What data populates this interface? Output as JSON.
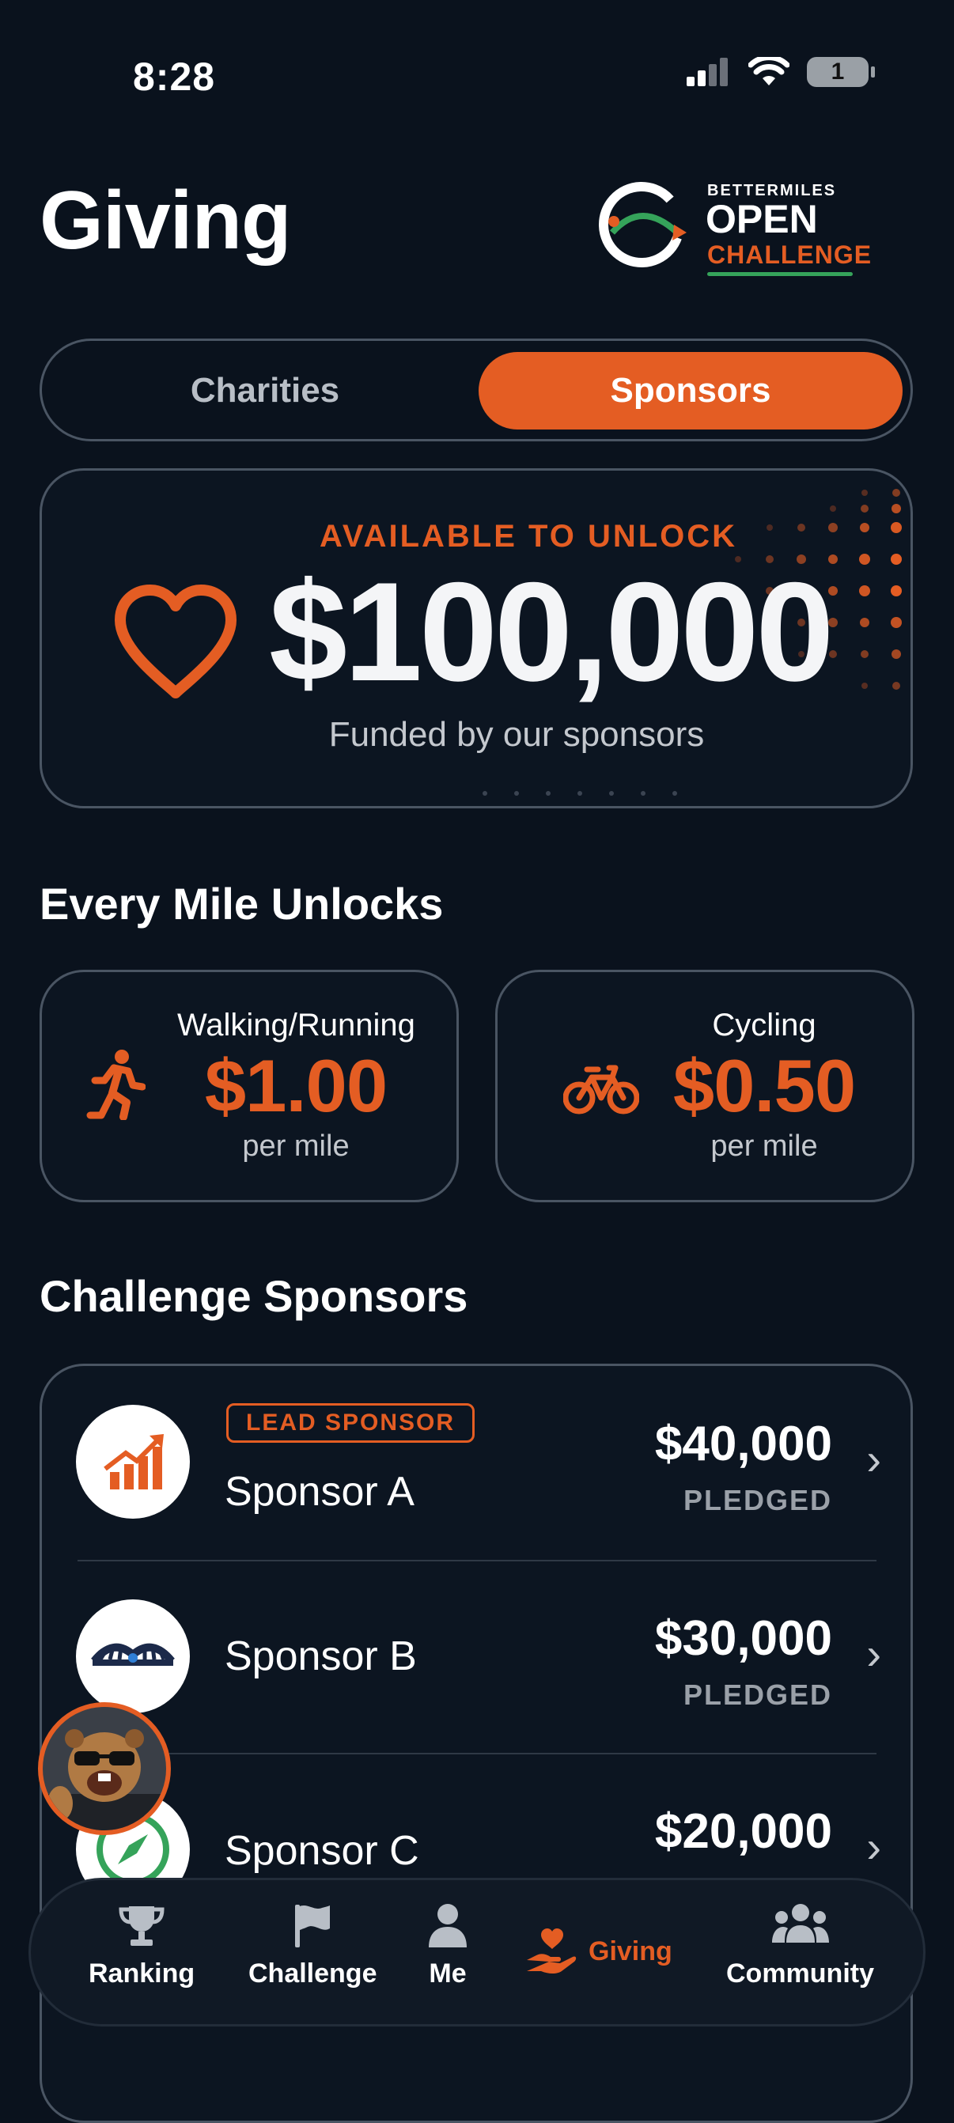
{
  "status": {
    "time": "8:28",
    "battery": "1"
  },
  "header": {
    "title": "Giving",
    "logo": {
      "small": "BETTERMILES",
      "open": "OPEN",
      "challenge": "CHALLENGE"
    }
  },
  "tabs": {
    "charities": "Charities",
    "sponsors": "Sponsors",
    "selected": "Sponsors"
  },
  "available": {
    "label": "AVAILABLE TO UNLOCK",
    "amount": "$100,000",
    "subtitle": "Funded by our sponsors"
  },
  "unlocks": {
    "title": "Every Mile Unlocks",
    "walking": {
      "label": "Walking/Running",
      "value": "$1.00",
      "unit": "per mile"
    },
    "cycling": {
      "label": "Cycling",
      "value": "$0.50",
      "unit": "per mile"
    }
  },
  "sponsors": {
    "title": "Challenge Sponsors",
    "items": [
      {
        "badge": "LEAD SPONSOR",
        "name": "Sponsor A",
        "amount": "$40,000",
        "status": "PLEDGED"
      },
      {
        "name": "Sponsor B",
        "amount": "$30,000",
        "status": "PLEDGED"
      },
      {
        "name": "Sponsor C",
        "amount": "$20,000"
      }
    ]
  },
  "nav": {
    "items": [
      {
        "label": "Ranking"
      },
      {
        "label": "Challenge"
      },
      {
        "label": "Me"
      },
      {
        "label": "Giving"
      },
      {
        "label": "Community"
      }
    ],
    "active": "Giving"
  },
  "colors": {
    "accent": "#e45d23",
    "background": "#0a121d",
    "green": "#35a35a"
  }
}
